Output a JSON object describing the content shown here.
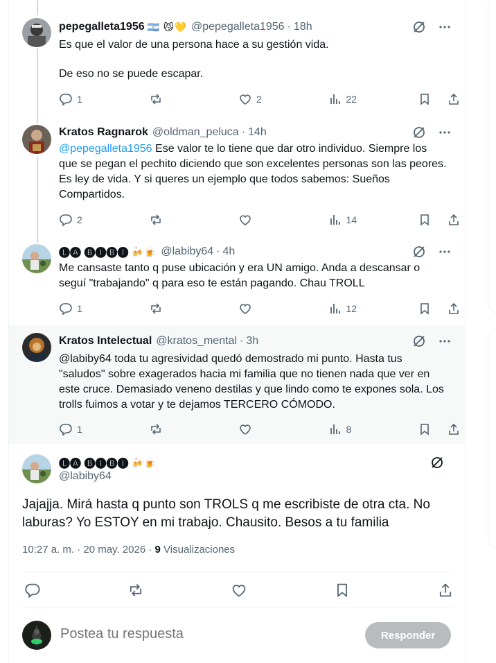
{
  "replies": [
    {
      "name": "pepegalleta1956",
      "emoji": "🇦🇷 😼💛",
      "handle": "@pepegalleta1956",
      "time": "18h",
      "text": [
        "Es que el valor de una persona hace a su gestión vida.",
        "De eso no se puede escapar."
      ],
      "counts": {
        "replies": "1",
        "reposts": "",
        "likes": "2",
        "views": "22"
      }
    },
    {
      "name": "Kratos Ragnarok",
      "emoji": "",
      "handle": "@oldman_peluca",
      "time": "14h",
      "mention": "@pepegalleta1956",
      "text_after_mention": " Ese valor te lo tiene que dar otro individuo. Siempre los que se pegan el pechito diciendo que son excelentes personas son las peores. Es ley de vida. Y si queres un ejemplo que todos sabemos: Sueños Compartidos.",
      "counts": {
        "replies": "2",
        "reposts": "",
        "likes": "",
        "views": "14"
      }
    },
    {
      "name": "🅛🅐 🅑🅘🅑🅘",
      "emoji": "🍻🍺",
      "handle": "@labiby64",
      "time": "4h",
      "text": [
        "Me cansaste tanto q puse ubicación y era UN amigo.  Anda a descansar o seguí \"trabajando\" q para eso te están pagando. Chau TROLL"
      ],
      "counts": {
        "replies": "1",
        "reposts": "",
        "likes": "",
        "views": "12"
      }
    },
    {
      "name": "Kratos Intelectual",
      "emoji": "",
      "handle": "@kratos_mental",
      "time": "3h",
      "text": [
        "@labiby64 toda tu agresividad quedó demostrado mi punto. Hasta tus \"saludos\" sobre exagerados hacia mi familia que no tienen nada que ver en este cruce. Demasiado veneno destilas y que lindo como te expones sola. Los trolls fuimos a votar y te dejamos TERCERO CÓMODO."
      ],
      "counts": {
        "replies": "1",
        "reposts": "",
        "likes": "",
        "views": "8"
      }
    }
  ],
  "main_post": {
    "name": "🅛🅐 🅑🅘🅑🅘",
    "emoji": "🍻🍺",
    "handle": "@labiby64",
    "text": "Jajajja. Mirá hasta q punto son TROLS q me escribiste de otra cta. No laburas? Yo ESTOY en mi trabajo. Chausito. Besos a tu familia",
    "time": "10:27 a. m.",
    "date": "20 may. 2026",
    "views_count": "9",
    "views_label": "Visualizaciones"
  },
  "compose": {
    "placeholder": "Postea tu respuesta",
    "button": "Responder"
  },
  "colors": {
    "accent": "#1d9bf0",
    "muted": "#536471",
    "text": "#0f1419",
    "button_disabled": "#b9bcbe"
  },
  "icons": [
    "grok-icon",
    "more-icon",
    "reply-icon",
    "repost-icon",
    "like-icon",
    "views-icon",
    "bookmark-icon",
    "share-icon"
  ]
}
